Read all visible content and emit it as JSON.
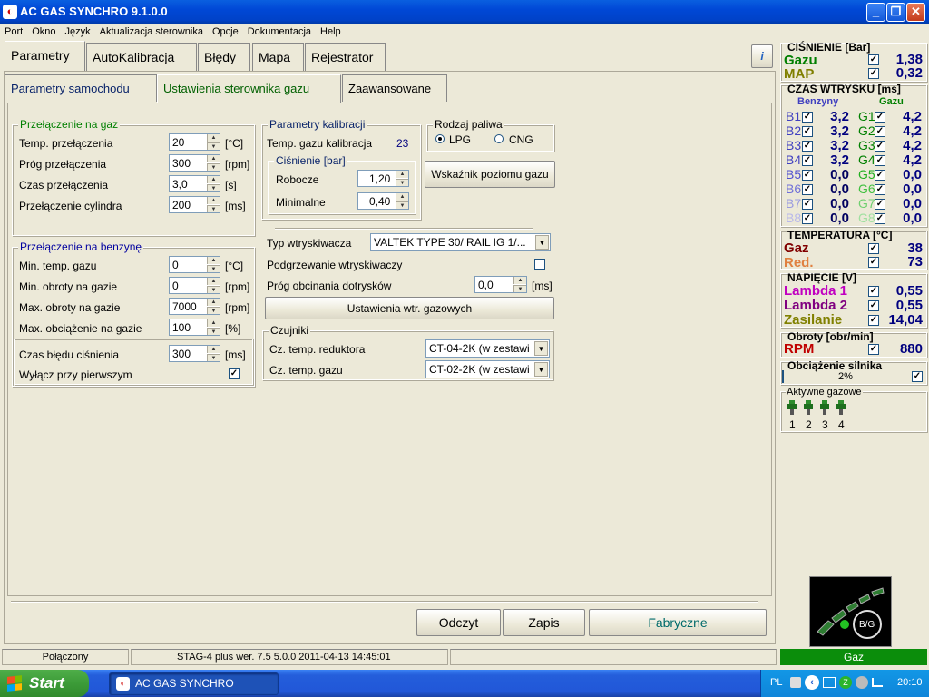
{
  "window": {
    "title": "AC GAS SYNCHRO  9.1.0.0",
    "minimize": "_",
    "maximize": "❐",
    "close": "✕",
    "app_icon": "gas-app-icon"
  },
  "menu": [
    "Port",
    "Okno",
    "Język",
    "Aktualizacja sterownika",
    "Opcje",
    "Dokumentacja",
    "Help"
  ],
  "tabs": [
    "Parametry",
    "AutoKalibracja",
    "Błędy",
    "Mapa",
    "Rejestrator"
  ],
  "subtabs": [
    "Parametry samochodu",
    "Ustawienia sterownika gazu",
    "Zaawansowane"
  ],
  "switch_gas": {
    "title": "Przełączenie na gaz",
    "rows": [
      {
        "label": "Temp. przełączenia",
        "value": "20",
        "unit": "[°C]"
      },
      {
        "label": "Próg przełączenia",
        "value": "300",
        "unit": "[rpm]"
      },
      {
        "label": "Czas przełączenia",
        "value": "3,0",
        "unit": "[s]"
      },
      {
        "label": "Przełączenie cylindra",
        "value": "200",
        "unit": "[ms]"
      }
    ]
  },
  "switch_petrol": {
    "title": "Przełączenie na benzynę",
    "rows": [
      {
        "label": "Min. temp. gazu",
        "value": "0",
        "unit": "[°C]"
      },
      {
        "label": "Min. obroty na gazie",
        "value": "0",
        "unit": "[rpm]"
      },
      {
        "label": "Max. obroty na gazie",
        "value": "7000",
        "unit": "[rpm]"
      },
      {
        "label": "Max. obciążenie na gazie",
        "value": "100",
        "unit": "[%]"
      }
    ],
    "error_time_label": "Czas błędu ciśnienia",
    "error_time_value": "300",
    "error_time_unit": "[ms]",
    "disable_first_label": "Wyłącz przy pierwszym",
    "disable_first_checked": true
  },
  "calibration": {
    "title": "Parametry kalibracji",
    "gas_temp_label": "Temp. gazu kalibracja",
    "gas_temp_value": "23",
    "pressure_title": "Ciśnienie [bar]",
    "working_label": "Robocze",
    "working_value": "1,20",
    "minimal_label": "Minimalne",
    "minimal_value": "0,40"
  },
  "fuel": {
    "title": "Rodzaj paliwa",
    "options": [
      "LPG",
      "CNG"
    ],
    "selected": "LPG"
  },
  "gas_level_button": "Wskaźnik poziomu gazu",
  "injector": {
    "type_label": "Typ wtryskiwacza",
    "type_value": "VALTEK TYPE 30/ RAIL IG 1/...",
    "heating_label": "Podgrzewanie wtryskiwaczy",
    "heating_checked": false,
    "cutoff_label": "Próg obcinania dotrysków",
    "cutoff_value": "0,0",
    "cutoff_unit": "[ms]",
    "settings_button": "Ustawienia wtr. gazowych"
  },
  "sensors": {
    "title": "Czujniki",
    "reducer_label": "Cz. temp. reduktora",
    "reducer_value": "CT-04-2K (w zestawi",
    "gas_label": "Cz. temp. gazu",
    "gas_value": "CT-02-2K (w zestawi"
  },
  "bottom_buttons": {
    "read": "Odczyt",
    "write": "Zapis",
    "factory": "Fabryczne"
  },
  "info_icon": "info-icon",
  "right": {
    "pressure_title": "CIŚNIENIE [Bar]",
    "gas_label": "Gazu",
    "gas_value": "1,38",
    "map_label": "MAP",
    "map_value": "0,32",
    "inj_title": "CZAS WTRYSKU  [ms]",
    "petrol_head": "Benzyny",
    "gas_head": "Gazu",
    "injections": [
      {
        "b": "B1",
        "bv": "3,2",
        "g": "G1",
        "gv": "4,2"
      },
      {
        "b": "B2",
        "bv": "3,2",
        "g": "G2",
        "gv": "4,2"
      },
      {
        "b": "B3",
        "bv": "3,2",
        "g": "G3",
        "gv": "4,2"
      },
      {
        "b": "B4",
        "bv": "3,2",
        "g": "G4",
        "gv": "4,2"
      },
      {
        "b": "B5",
        "bv": "0,0",
        "g": "G5",
        "gv": "0,0"
      },
      {
        "b": "B6",
        "bv": "0,0",
        "g": "G6",
        "gv": "0,0"
      },
      {
        "b": "B7",
        "bv": "0,0",
        "g": "G7",
        "gv": "0,0"
      },
      {
        "b": "B8",
        "bv": "0,0",
        "g": "G8",
        "gv": "0,0"
      }
    ],
    "temp_title": "TEMPERATURA  [°C]",
    "temp_gas_label": "Gaz",
    "temp_gas_value": "38",
    "temp_red_label": "Red.",
    "temp_red_value": "73",
    "volt_title": "NAPIĘCIE [V]",
    "lambda1_label": "Lambda 1",
    "lambda1_value": "0,55",
    "lambda2_label": "Lambda 2",
    "lambda2_value": "0,55",
    "supply_label": "Zasilanie",
    "supply_value": "14,04",
    "rpm_title": "Obroty [obr/min]",
    "rpm_label": "RPM",
    "rpm_value": "880",
    "load_title": "Obciążenie silnika",
    "load_value": "2%",
    "active_title": "Aktywne gazowe",
    "active_injectors": [
      "1",
      "2",
      "3",
      "4"
    ],
    "mode_label": "B/G",
    "status_mode": "Gaz"
  },
  "status": {
    "connection": "Połączony",
    "controller": "STAG-4 plus   wer. 7.5  5.0.0    2011-04-13 14:45:01"
  },
  "taskbar": {
    "start": "Start",
    "app": "AC GAS SYNCHRO",
    "lang": "PL",
    "clock": "20:10"
  },
  "colors": {
    "gas_green": "#007f00",
    "map_olive": "#7f7f00",
    "petrol_blue": "#4040c0",
    "value_navy": "#00007f",
    "lambda1": "#c000c0",
    "lambda2": "#800080",
    "supply": "#808000",
    "rpm_red": "#c00000",
    "temp_red": "#c0602c",
    "temp_gas": "#800000"
  }
}
